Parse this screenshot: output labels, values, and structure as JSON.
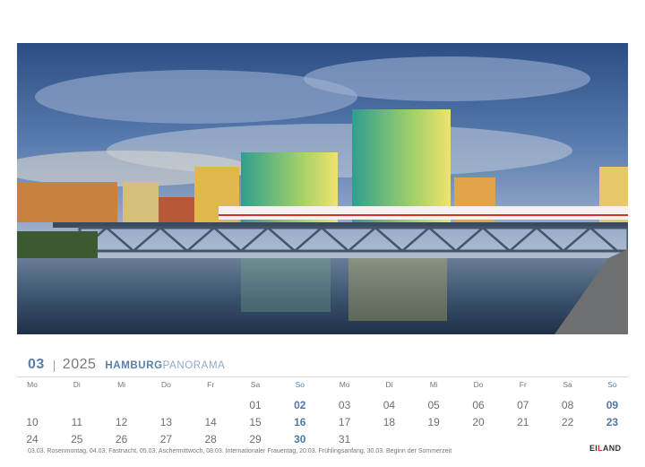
{
  "calendar": {
    "month": "03",
    "year": "2025",
    "title_bold": "HAMBURG",
    "title_light": "PANORAMA",
    "weekday_headers": [
      "Mo",
      "Di",
      "Mi",
      "Do",
      "Fr",
      "Sa",
      "So",
      "Mo",
      "Di",
      "Mi",
      "Do",
      "Fr",
      "Sa",
      "So"
    ],
    "rows": [
      [
        "",
        "",
        "",
        "",
        "",
        "01",
        "02",
        "03",
        "04",
        "05",
        "06",
        "07",
        "08",
        "09"
      ],
      [
        "10",
        "11",
        "12",
        "13",
        "14",
        "15",
        "16",
        "17",
        "18",
        "19",
        "20",
        "21",
        "22",
        "23"
      ],
      [
        "24",
        "25",
        "26",
        "27",
        "28",
        "29",
        "30",
        "31",
        "",
        "",
        "",
        "",
        "",
        ""
      ]
    ],
    "holidays": "03.03. Rosenmontag, 04.03. Fastnacht, 05.03. Aschermittwoch, 08.03. Internationaler Frauentag, 20.03. Frühlingsanfang, 30.03. Beginn der Sommerzeit"
  },
  "brand": {
    "logo_text_a": "EI",
    "logo_text_b": "L",
    "logo_text_c": "AND"
  },
  "photo": {
    "subject": "Hamburg skyline with train crossing bridge over water"
  },
  "colors": {
    "accent": "#5a7fa8",
    "sunday": "#4f78a6"
  }
}
